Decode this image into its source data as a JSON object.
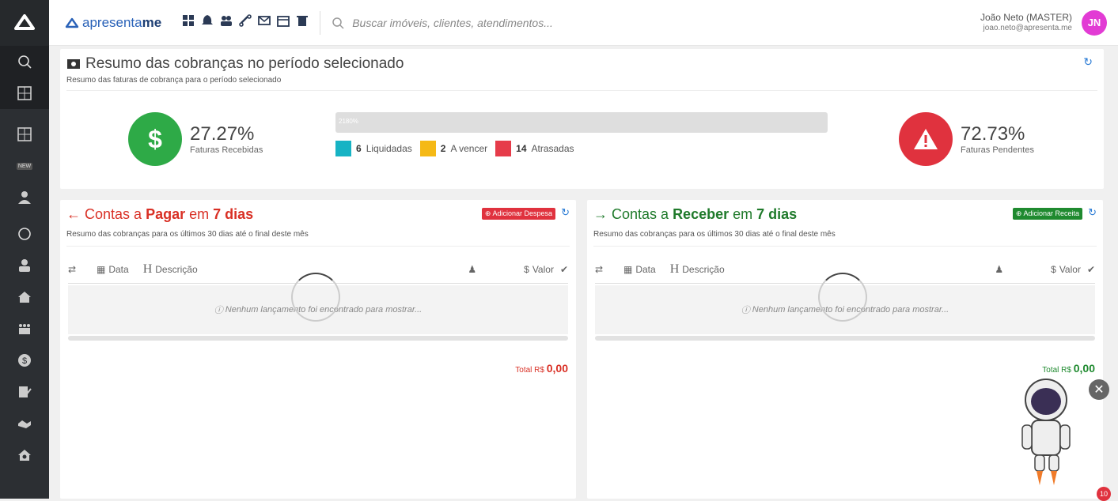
{
  "app": {
    "brand_light": "apresenta",
    "brand_bold": "me",
    "search_placeholder": "Buscar imóveis, clientes, atendimentos..."
  },
  "user": {
    "name": "João Neto (MASTER)",
    "email": "joao.neto@apresenta.me",
    "initials": "JN"
  },
  "summary": {
    "title": "Resumo das cobranças no período selecionado",
    "subtitle": "Resumo das faturas de cobrança para o período selecionado",
    "received_pct": "27.27%",
    "received_label": "Faturas Recebidas",
    "pending_pct": "72.73%",
    "pending_label": "Faturas Pendentes",
    "bar_text": "2180%",
    "legend": [
      {
        "count": "6",
        "label": "Liquidadas",
        "color": "#17b3c4"
      },
      {
        "count": "2",
        "label": "A vencer",
        "color": "#f5b916"
      },
      {
        "count": "14",
        "label": "Atrasadas",
        "color": "#e63c4a"
      }
    ]
  },
  "pay": {
    "t1": "Contas a ",
    "t2": "Pagar",
    "t3": " em ",
    "t4": "7 dias",
    "subtitle": "Resumo das cobranças para os últimos 30 dias até o final deste mês",
    "add_label": "Adicionar Despesa",
    "col_date": "Data",
    "col_desc": "Descrição",
    "col_value": "Valor",
    "empty": "Nenhum lançamento foi encontrado para mostrar...",
    "total_label": "Total R$",
    "total_value": "0,00"
  },
  "recv": {
    "t1": "Contas a ",
    "t2": "Receber",
    "t3": " em ",
    "t4": "7 dias",
    "subtitle": "Resumo das cobranças para os últimos 30 dias até o final deste mês",
    "add_label": "Adicionar Receita",
    "col_date": "Data",
    "col_desc": "Descrição",
    "col_value": "Valor",
    "empty": "Nenhum lançamento foi encontrado para mostrar...",
    "total_label": "Total R$",
    "total_value": "0,00"
  },
  "notification_badge": "10",
  "sidebar_badge": "NEW",
  "colors": {
    "green": "#2eaa47",
    "red": "#e0323e"
  }
}
